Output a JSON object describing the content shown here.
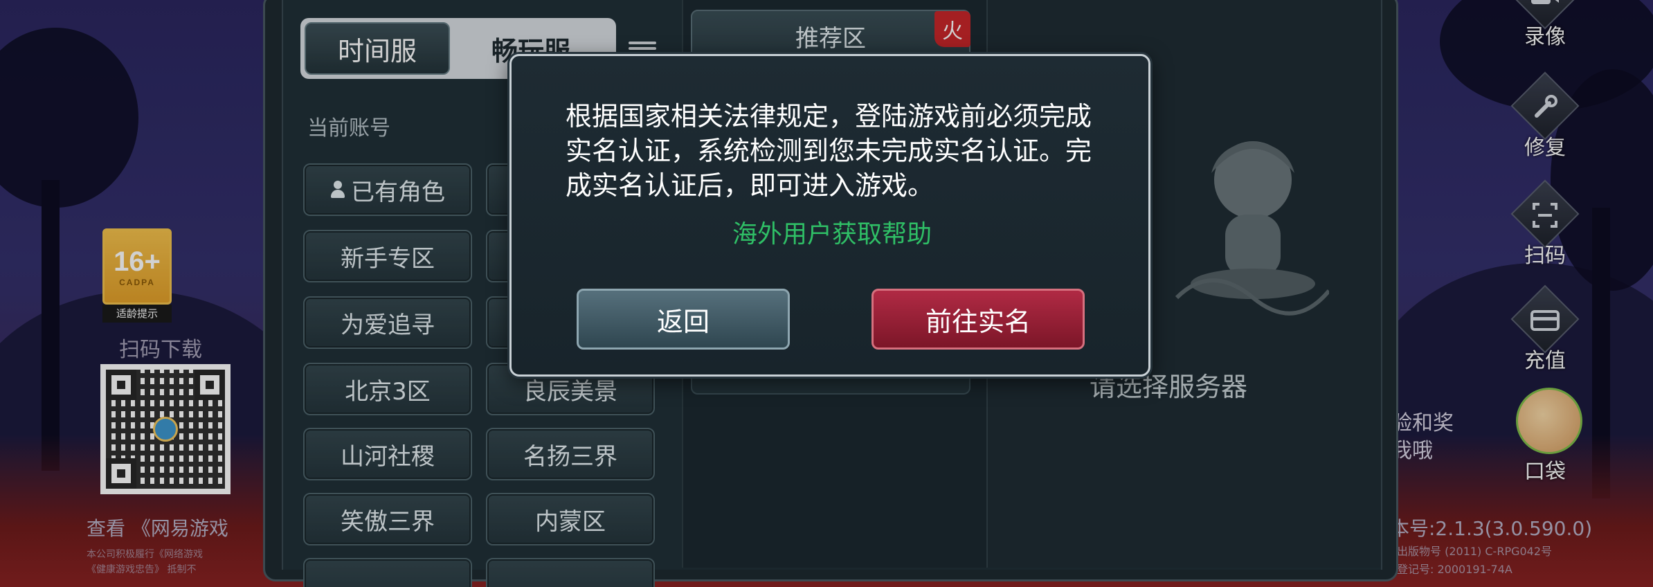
{
  "background": {
    "scan_download": "扫码下载",
    "age_badge": {
      "rating": "16+",
      "org": "CADPA",
      "caption": "适龄提示"
    },
    "footer_left": {
      "title": "查看 《网易游戏",
      "line1": "本公司积极履行《网络游戏",
      "line2": "《健康游戏忠告》 抵制不"
    },
    "version": "本号:2.1.3(3.0.590.0)",
    "license_line1": "出版物号 (2011) C-RPG042号",
    "license_line2": "登记号: 2000191-74A",
    "pocket_tip_line1": "验和奖",
    "pocket_tip_line2": "我哦"
  },
  "sidebar_right": {
    "record": "录像",
    "repair": "修复",
    "scan": "扫码",
    "recharge": "充值",
    "pocket": "口袋"
  },
  "server_panel": {
    "tabs": {
      "active": "时间服",
      "inactive": "畅玩服"
    },
    "account_label": "当前账号",
    "left_column": [
      "已有角色",
      "新手专区",
      "为爱追寻",
      "北京3区",
      "山河社稷",
      "笑傲三界"
    ],
    "right_column": [
      "良辰美景",
      "名扬三界",
      "内蒙区"
    ],
    "recommended": "推荐区",
    "hot_badge": "火",
    "select_prompt": "请选择服务器"
  },
  "modal": {
    "message": "根据国家相关法律规定，登陆游戏前必须完成实名认证，系统检测到您未完成实名认证。完成实名认证后，即可进入游戏。",
    "help_link": "海外用户获取帮助",
    "back_button": "返回",
    "verify_button": "前往实名"
  },
  "colors": {
    "help_link": "#2fbf66",
    "verify_button": "#9a2034",
    "hot_badge": "#c8262a"
  }
}
